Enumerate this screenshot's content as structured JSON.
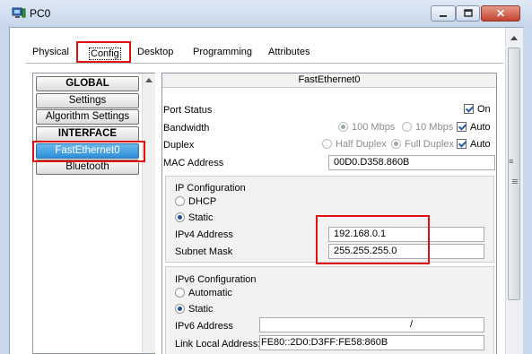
{
  "window": {
    "title": "PC0"
  },
  "tabs": [
    {
      "label": "Physical"
    },
    {
      "label": "Config"
    },
    {
      "label": "Desktop"
    },
    {
      "label": "Programming"
    },
    {
      "label": "Attributes"
    }
  ],
  "sidebar": {
    "items": [
      {
        "label": "GLOBAL"
      },
      {
        "label": "Settings"
      },
      {
        "label": "Algorithm Settings"
      },
      {
        "label": "INTERFACE"
      },
      {
        "label": "FastEthernet0"
      },
      {
        "label": "Bluetooth"
      }
    ]
  },
  "panel": {
    "title": "FastEthernet0",
    "port_status": {
      "label": "Port Status",
      "on_label": "On",
      "on_checked": true
    },
    "bandwidth": {
      "label": "Bandwidth",
      "opt1": "100 Mbps",
      "opt2": "10 Mbps",
      "auto_label": "Auto",
      "auto_checked": true
    },
    "duplex": {
      "label": "Duplex",
      "opt1": "Half Duplex",
      "opt2": "Full Duplex",
      "auto_label": "Auto",
      "auto_checked": true
    },
    "mac": {
      "label": "MAC Address",
      "value": "00D0.D358.860B"
    },
    "ipv4": {
      "section_title": "IP Configuration",
      "dhcp_label": "DHCP",
      "static_label": "Static",
      "mode": "Static",
      "address_label": "IPv4 Address",
      "address_value": "192.168.0.1",
      "mask_label": "Subnet Mask",
      "mask_value": "255.255.255.0"
    },
    "ipv6": {
      "section_title": "IPv6 Configuration",
      "automatic_label": "Automatic",
      "static_label": "Static",
      "mode": "Static",
      "address_label": "IPv6 Address",
      "address_value": "",
      "prefix_sep": "/",
      "link_local_label": "Link Local Address:",
      "link_local_value": "FE80::2D0:D3FF:FE58:860B"
    }
  },
  "colors": {
    "highlight": "#e01010",
    "selected": "#3d9be0"
  },
  "icons": [
    "pc-app-icon",
    "minimize-icon",
    "maximize-icon",
    "close-icon",
    "scroll-up-icon"
  ]
}
